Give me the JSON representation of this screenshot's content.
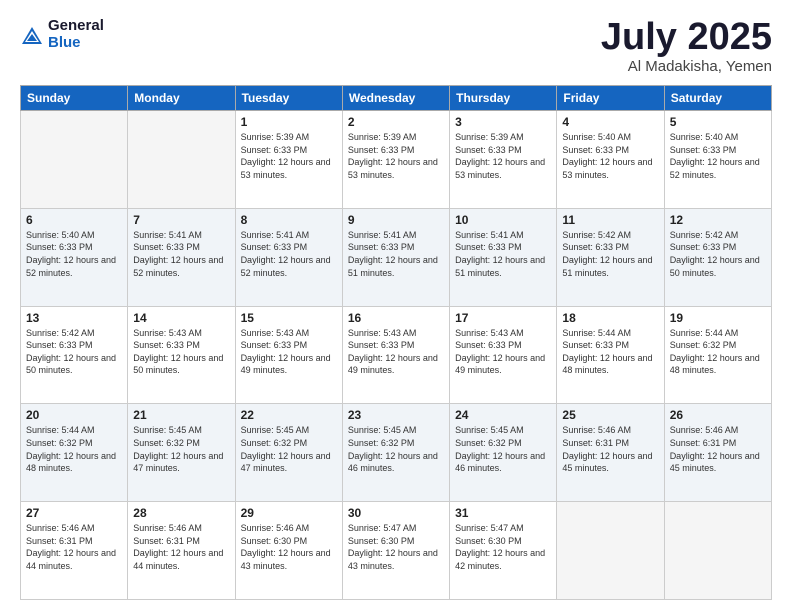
{
  "header": {
    "logo_general": "General",
    "logo_blue": "Blue",
    "title": "July 2025",
    "location": "Al Madakisha, Yemen"
  },
  "days_of_week": [
    "Sunday",
    "Monday",
    "Tuesday",
    "Wednesday",
    "Thursday",
    "Friday",
    "Saturday"
  ],
  "weeks": [
    [
      {
        "day": "",
        "empty": true
      },
      {
        "day": "",
        "empty": true
      },
      {
        "day": "1",
        "sunrise": "Sunrise: 5:39 AM",
        "sunset": "Sunset: 6:33 PM",
        "daylight": "Daylight: 12 hours and 53 minutes."
      },
      {
        "day": "2",
        "sunrise": "Sunrise: 5:39 AM",
        "sunset": "Sunset: 6:33 PM",
        "daylight": "Daylight: 12 hours and 53 minutes."
      },
      {
        "day": "3",
        "sunrise": "Sunrise: 5:39 AM",
        "sunset": "Sunset: 6:33 PM",
        "daylight": "Daylight: 12 hours and 53 minutes."
      },
      {
        "day": "4",
        "sunrise": "Sunrise: 5:40 AM",
        "sunset": "Sunset: 6:33 PM",
        "daylight": "Daylight: 12 hours and 53 minutes."
      },
      {
        "day": "5",
        "sunrise": "Sunrise: 5:40 AM",
        "sunset": "Sunset: 6:33 PM",
        "daylight": "Daylight: 12 hours and 52 minutes."
      }
    ],
    [
      {
        "day": "6",
        "sunrise": "Sunrise: 5:40 AM",
        "sunset": "Sunset: 6:33 PM",
        "daylight": "Daylight: 12 hours and 52 minutes."
      },
      {
        "day": "7",
        "sunrise": "Sunrise: 5:41 AM",
        "sunset": "Sunset: 6:33 PM",
        "daylight": "Daylight: 12 hours and 52 minutes."
      },
      {
        "day": "8",
        "sunrise": "Sunrise: 5:41 AM",
        "sunset": "Sunset: 6:33 PM",
        "daylight": "Daylight: 12 hours and 52 minutes."
      },
      {
        "day": "9",
        "sunrise": "Sunrise: 5:41 AM",
        "sunset": "Sunset: 6:33 PM",
        "daylight": "Daylight: 12 hours and 51 minutes."
      },
      {
        "day": "10",
        "sunrise": "Sunrise: 5:41 AM",
        "sunset": "Sunset: 6:33 PM",
        "daylight": "Daylight: 12 hours and 51 minutes."
      },
      {
        "day": "11",
        "sunrise": "Sunrise: 5:42 AM",
        "sunset": "Sunset: 6:33 PM",
        "daylight": "Daylight: 12 hours and 51 minutes."
      },
      {
        "day": "12",
        "sunrise": "Sunrise: 5:42 AM",
        "sunset": "Sunset: 6:33 PM",
        "daylight": "Daylight: 12 hours and 50 minutes."
      }
    ],
    [
      {
        "day": "13",
        "sunrise": "Sunrise: 5:42 AM",
        "sunset": "Sunset: 6:33 PM",
        "daylight": "Daylight: 12 hours and 50 minutes."
      },
      {
        "day": "14",
        "sunrise": "Sunrise: 5:43 AM",
        "sunset": "Sunset: 6:33 PM",
        "daylight": "Daylight: 12 hours and 50 minutes."
      },
      {
        "day": "15",
        "sunrise": "Sunrise: 5:43 AM",
        "sunset": "Sunset: 6:33 PM",
        "daylight": "Daylight: 12 hours and 49 minutes."
      },
      {
        "day": "16",
        "sunrise": "Sunrise: 5:43 AM",
        "sunset": "Sunset: 6:33 PM",
        "daylight": "Daylight: 12 hours and 49 minutes."
      },
      {
        "day": "17",
        "sunrise": "Sunrise: 5:43 AM",
        "sunset": "Sunset: 6:33 PM",
        "daylight": "Daylight: 12 hours and 49 minutes."
      },
      {
        "day": "18",
        "sunrise": "Sunrise: 5:44 AM",
        "sunset": "Sunset: 6:33 PM",
        "daylight": "Daylight: 12 hours and 48 minutes."
      },
      {
        "day": "19",
        "sunrise": "Sunrise: 5:44 AM",
        "sunset": "Sunset: 6:32 PM",
        "daylight": "Daylight: 12 hours and 48 minutes."
      }
    ],
    [
      {
        "day": "20",
        "sunrise": "Sunrise: 5:44 AM",
        "sunset": "Sunset: 6:32 PM",
        "daylight": "Daylight: 12 hours and 48 minutes."
      },
      {
        "day": "21",
        "sunrise": "Sunrise: 5:45 AM",
        "sunset": "Sunset: 6:32 PM",
        "daylight": "Daylight: 12 hours and 47 minutes."
      },
      {
        "day": "22",
        "sunrise": "Sunrise: 5:45 AM",
        "sunset": "Sunset: 6:32 PM",
        "daylight": "Daylight: 12 hours and 47 minutes."
      },
      {
        "day": "23",
        "sunrise": "Sunrise: 5:45 AM",
        "sunset": "Sunset: 6:32 PM",
        "daylight": "Daylight: 12 hours and 46 minutes."
      },
      {
        "day": "24",
        "sunrise": "Sunrise: 5:45 AM",
        "sunset": "Sunset: 6:32 PM",
        "daylight": "Daylight: 12 hours and 46 minutes."
      },
      {
        "day": "25",
        "sunrise": "Sunrise: 5:46 AM",
        "sunset": "Sunset: 6:31 PM",
        "daylight": "Daylight: 12 hours and 45 minutes."
      },
      {
        "day": "26",
        "sunrise": "Sunrise: 5:46 AM",
        "sunset": "Sunset: 6:31 PM",
        "daylight": "Daylight: 12 hours and 45 minutes."
      }
    ],
    [
      {
        "day": "27",
        "sunrise": "Sunrise: 5:46 AM",
        "sunset": "Sunset: 6:31 PM",
        "daylight": "Daylight: 12 hours and 44 minutes."
      },
      {
        "day": "28",
        "sunrise": "Sunrise: 5:46 AM",
        "sunset": "Sunset: 6:31 PM",
        "daylight": "Daylight: 12 hours and 44 minutes."
      },
      {
        "day": "29",
        "sunrise": "Sunrise: 5:46 AM",
        "sunset": "Sunset: 6:30 PM",
        "daylight": "Daylight: 12 hours and 43 minutes."
      },
      {
        "day": "30",
        "sunrise": "Sunrise: 5:47 AM",
        "sunset": "Sunset: 6:30 PM",
        "daylight": "Daylight: 12 hours and 43 minutes."
      },
      {
        "day": "31",
        "sunrise": "Sunrise: 5:47 AM",
        "sunset": "Sunset: 6:30 PM",
        "daylight": "Daylight: 12 hours and 42 minutes."
      },
      {
        "day": "",
        "empty": true
      },
      {
        "day": "",
        "empty": true
      }
    ]
  ]
}
